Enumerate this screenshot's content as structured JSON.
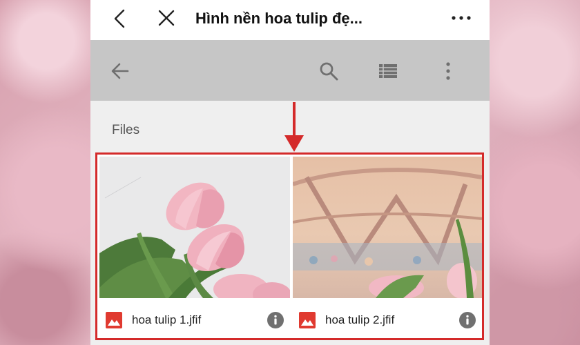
{
  "header": {
    "title": "Hình nền hoa tulip đẹ...",
    "icons": [
      "chevron-left-icon",
      "close-icon",
      "more-horizontal-icon"
    ]
  },
  "toolbar": {
    "icons": [
      "arrow-left-icon",
      "search-icon",
      "list-view-icon",
      "more-vertical-icon"
    ],
    "color": "#c6c6c6"
  },
  "section": {
    "label": "Files"
  },
  "files": [
    {
      "name": "hoa tulip 1.jfif",
      "type_icon": "image-icon",
      "action_icon": "info-icon"
    },
    {
      "name": "hoa tulip 2.jfif",
      "type_icon": "image-icon",
      "action_icon": "info-icon"
    }
  ],
  "highlight": {
    "color": "#d42a2a",
    "pointer": "down-arrow-icon"
  }
}
